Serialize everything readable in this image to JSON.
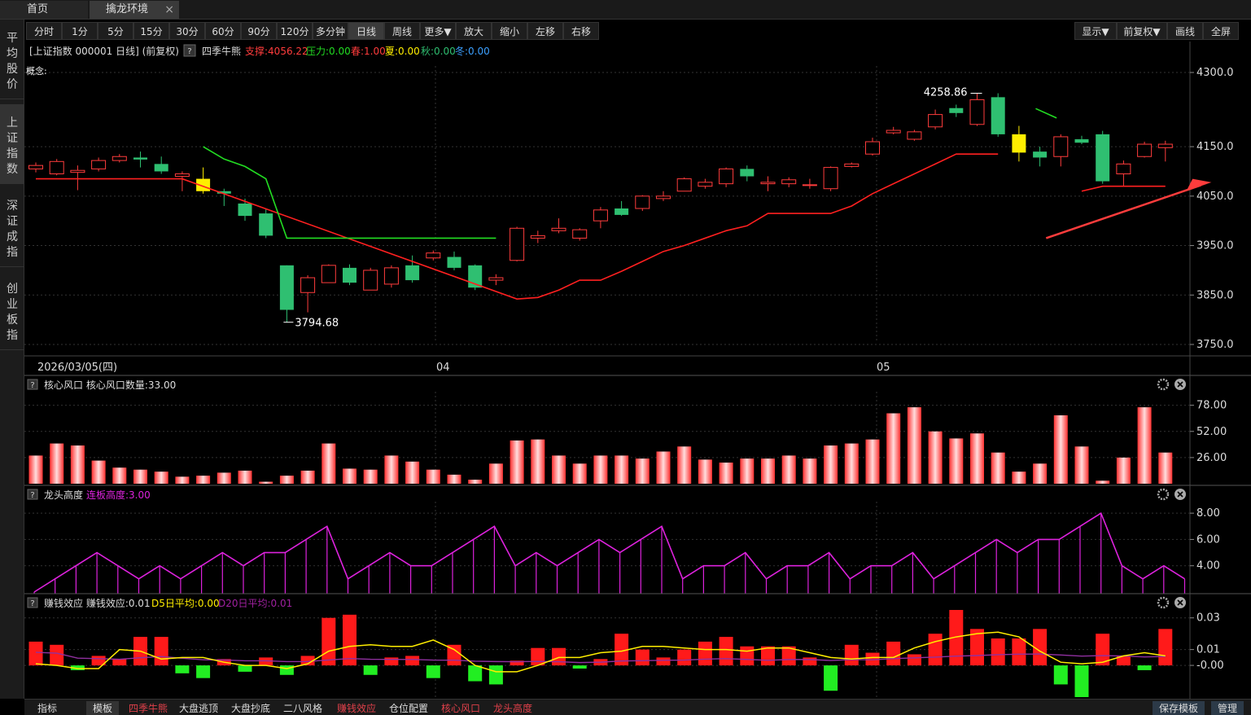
{
  "window_tabs": {
    "home": "首页",
    "env": "擒龙环境",
    "close": "×"
  },
  "left_nav": [
    "平均股价",
    "上证指数",
    "深证成指",
    "创业板指"
  ],
  "toolbar": {
    "periods": [
      "分时",
      "1分",
      "5分",
      "15分",
      "30分",
      "60分",
      "90分",
      "120分",
      "多分钟",
      "日线",
      "周线",
      "更多▼",
      "放大",
      "缩小",
      "左移",
      "右移"
    ],
    "active": "日线",
    "right": [
      "显示▼",
      "前复权▼",
      "画线",
      "全屏"
    ]
  },
  "main_chart": {
    "info_prefix": "[上证指数 000001 日线]  (前复权)",
    "help": "?",
    "indicator_name": "四季牛熊",
    "support": "支撑:4056.22",
    "pressure": "压力:0.00",
    "spring": "春:1.00",
    "summer": "夏:0.00",
    "autumn": "秋:0.00",
    "winter": "冬:0.00",
    "concept": "概念:",
    "date_label": "2026/03/05(四)",
    "month_labels": [
      "04",
      "05"
    ],
    "high_label": "4258.86",
    "low_label": "3794.68",
    "y_ticks": [
      "4300.0",
      "4150.0",
      "4050.0",
      "3950.0",
      "3850.0",
      "3750.0"
    ]
  },
  "panel1": {
    "help": "?",
    "title": "核心风口 核心风口数量:33.00",
    "y_ticks": [
      "78.00",
      "52.00",
      "26.00"
    ]
  },
  "panel2": {
    "help": "?",
    "title": "龙头高度",
    "value": "连板高度:3.00",
    "y_ticks": [
      "8.00",
      "6.00",
      "4.00"
    ]
  },
  "panel3": {
    "help": "?",
    "title": "赚钱效应 赚钱效应:0.01",
    "d5": "D5日平均:0.00",
    "d20": "D20日平均:0.01",
    "y_ticks": [
      "0.03",
      "0.01",
      "-0.00"
    ]
  },
  "bottom": {
    "left": [
      "指标",
      "模板",
      "四季牛熊",
      "大盘逃顶",
      "大盘抄底",
      "二八风格",
      "赚钱效应",
      "仓位配置",
      "核心风口",
      "龙头高度"
    ],
    "right": [
      "保存模板",
      "管理"
    ]
  },
  "colors": {
    "up": "#ff3c3c",
    "down": "#2fbf71",
    "support_line": "#ff2020",
    "pressure_line": "#22dd22",
    "magenta": "#dd22dd",
    "yellow": "#ffee00"
  },
  "chart_data": [
    {
      "type": "candlestick",
      "title": "上证指数 000001 日线",
      "ylim": [
        3750,
        4300
      ],
      "candles": [
        {
          "o": 4105,
          "c": 4112,
          "h": 4118,
          "l": 4098
        },
        {
          "o": 4095,
          "c": 4120,
          "h": 4125,
          "l": 4092
        },
        {
          "o": 4098,
          "c": 4102,
          "h": 4112,
          "l": 4062
        },
        {
          "o": 4105,
          "c": 4122,
          "h": 4128,
          "l": 4100
        },
        {
          "o": 4122,
          "c": 4130,
          "h": 4135,
          "l": 4118
        },
        {
          "o": 4128,
          "c": 4124,
          "h": 4140,
          "l": 4108
        },
        {
          "o": 4115,
          "c": 4100,
          "h": 4130,
          "l": 4095
        },
        {
          "o": 4090,
          "c": 4095,
          "h": 4100,
          "l": 4060
        },
        {
          "o": 4085,
          "c": 4060,
          "h": 4108,
          "l": 4055
        },
        {
          "o": 4060,
          "c": 4055,
          "h": 4065,
          "l": 4030
        },
        {
          "o": 4035,
          "c": 4010,
          "h": 4045,
          "l": 4000
        },
        {
          "o": 4015,
          "c": 3970,
          "h": 4025,
          "l": 3965
        },
        {
          "o": 3910,
          "c": 3820,
          "h": 3910,
          "l": 3795
        },
        {
          "o": 3855,
          "c": 3885,
          "h": 3890,
          "l": 3815
        },
        {
          "o": 3875,
          "c": 3910,
          "h": 3912,
          "l": 3875
        },
        {
          "o": 3905,
          "c": 3875,
          "h": 3912,
          "l": 3870
        },
        {
          "o": 3860,
          "c": 3900,
          "h": 3905,
          "l": 3860
        },
        {
          "o": 3872,
          "c": 3905,
          "h": 3910,
          "l": 3865
        },
        {
          "o": 3910,
          "c": 3880,
          "h": 3930,
          "l": 3875
        },
        {
          "o": 3925,
          "c": 3935,
          "h": 3940,
          "l": 3920
        },
        {
          "o": 3927,
          "c": 3905,
          "h": 3938,
          "l": 3900
        },
        {
          "o": 3910,
          "c": 3865,
          "h": 3912,
          "l": 3860
        },
        {
          "o": 3880,
          "c": 3885,
          "h": 3892,
          "l": 3870
        },
        {
          "o": 3920,
          "c": 3985,
          "h": 3988,
          "l": 3918
        },
        {
          "o": 3965,
          "c": 3970,
          "h": 3980,
          "l": 3955
        },
        {
          "o": 3980,
          "c": 3985,
          "h": 4005,
          "l": 3975
        },
        {
          "o": 3965,
          "c": 3982,
          "h": 3985,
          "l": 3960
        },
        {
          "o": 4000,
          "c": 4022,
          "h": 4028,
          "l": 3985
        },
        {
          "o": 4025,
          "c": 4012,
          "h": 4040,
          "l": 4010
        },
        {
          "o": 4025,
          "c": 4050,
          "h": 4052,
          "l": 4020
        },
        {
          "o": 4045,
          "c": 4050,
          "h": 4060,
          "l": 4040
        },
        {
          "o": 4060,
          "c": 4085,
          "h": 4088,
          "l": 4060
        },
        {
          "o": 4070,
          "c": 4078,
          "h": 4085,
          "l": 4065
        },
        {
          "o": 4075,
          "c": 4105,
          "h": 4108,
          "l": 4068
        },
        {
          "o": 4105,
          "c": 4090,
          "h": 4112,
          "l": 4080
        },
        {
          "o": 4075,
          "c": 4078,
          "h": 4090,
          "l": 4060
        },
        {
          "o": 4075,
          "c": 4083,
          "h": 4088,
          "l": 4068
        },
        {
          "o": 4072,
          "c": 4073,
          "h": 4085,
          "l": 4065
        },
        {
          "o": 4065,
          "c": 4108,
          "h": 4110,
          "l": 4060
        },
        {
          "o": 4110,
          "c": 4115,
          "h": 4118,
          "l": 4108
        },
        {
          "o": 4135,
          "c": 4160,
          "h": 4168,
          "l": 4132
        },
        {
          "o": 4178,
          "c": 4183,
          "h": 4190,
          "l": 4175
        },
        {
          "o": 4165,
          "c": 4180,
          "h": 4184,
          "l": 4162
        },
        {
          "o": 4190,
          "c": 4215,
          "h": 4225,
          "l": 4185
        },
        {
          "o": 4228,
          "c": 4218,
          "h": 4235,
          "l": 4210
        },
        {
          "o": 4195,
          "c": 4245,
          "h": 4258,
          "l": 4192
        },
        {
          "o": 4250,
          "c": 4175,
          "h": 4258,
          "l": 4170
        },
        {
          "o": 4175,
          "c": 4138,
          "h": 4192,
          "l": 4120
        },
        {
          "o": 4140,
          "c": 4128,
          "h": 4150,
          "l": 4110
        },
        {
          "o": 4130,
          "c": 4170,
          "h": 4175,
          "l": 4110
        },
        {
          "o": 4165,
          "c": 4158,
          "h": 4172,
          "l": 4155
        },
        {
          "o": 4175,
          "c": 4080,
          "h": 4182,
          "l": 4075
        },
        {
          "o": 4095,
          "c": 4115,
          "h": 4122,
          "l": 4070
        },
        {
          "o": 4130,
          "c": 4155,
          "h": 4160,
          "l": 4128
        },
        {
          "o": 4148,
          "c": 4155,
          "h": 4162,
          "l": 4120
        }
      ],
      "support_line": [
        [
          0,
          4085
        ],
        [
          7,
          4085
        ],
        [
          23,
          3842
        ],
        [
          24,
          3845
        ],
        [
          25,
          3860
        ],
        [
          26,
          3880
        ],
        [
          27,
          3880
        ],
        [
          28,
          3898
        ],
        [
          29,
          3918
        ],
        [
          30,
          3938
        ],
        [
          31,
          3950
        ],
        [
          32,
          3965
        ],
        [
          33,
          3980
        ],
        [
          34,
          3990
        ],
        [
          35,
          4015
        ],
        [
          36,
          4015
        ],
        [
          37,
          4015
        ],
        [
          38,
          4015
        ],
        [
          39,
          4030
        ],
        [
          40,
          4055
        ],
        [
          41,
          4075
        ],
        [
          42,
          4095
        ],
        [
          43,
          4115
        ],
        [
          44,
          4135
        ],
        [
          45,
          4135
        ],
        [
          46,
          4135
        ],
        [
          49,
          null
        ],
        [
          50,
          4060
        ],
        [
          51,
          4070
        ],
        [
          54,
          4070
        ]
      ],
      "pressure_line": [
        [
          8,
          4150
        ],
        [
          9,
          4125
        ],
        [
          10,
          4110
        ],
        [
          11,
          4085
        ],
        [
          12,
          3965
        ],
        [
          22,
          3965
        ]
      ]
    },
    {
      "type": "bar",
      "title": "核心风口",
      "ylim": [
        0,
        85
      ],
      "values": [
        28,
        40,
        38,
        23,
        16,
        14,
        12,
        7,
        8,
        11,
        13,
        2,
        8,
        13,
        40,
        15,
        14,
        28,
        22,
        14,
        9,
        4,
        20,
        43,
        44,
        28,
        20,
        28,
        28,
        25,
        32,
        37,
        24,
        21,
        25,
        25,
        28,
        25,
        38,
        40,
        44,
        70,
        76,
        52,
        45,
        50,
        31,
        12,
        20,
        68,
        37,
        3,
        26,
        76,
        31
      ]
    },
    {
      "type": "line",
      "title": "龙头高度",
      "ylim": [
        2,
        9
      ],
      "values": [
        2,
        3,
        4,
        5,
        4,
        3,
        4,
        3,
        4,
        5,
        4,
        5,
        5,
        6,
        7,
        3,
        4,
        5,
        4,
        4,
        5,
        6,
        7,
        4,
        5,
        4,
        5,
        6,
        5,
        6,
        7,
        3,
        4,
        4,
        5,
        3,
        4,
        4,
        5,
        3,
        4,
        4,
        5,
        3,
        4,
        5,
        6,
        5,
        6,
        6,
        7,
        8,
        4,
        3,
        4,
        3
      ]
    },
    {
      "type": "bar",
      "title": "赚钱效应",
      "ylim": [
        -0.02,
        0.035
      ],
      "values": [
        0.015,
        0.013,
        -0.003,
        0.006,
        0.004,
        0.018,
        0.018,
        -0.005,
        -0.008,
        0.004,
        -0.004,
        0.005,
        -0.006,
        0.006,
        0.03,
        0.032,
        -0.006,
        0.005,
        0.006,
        -0.008,
        0.013,
        -0.01,
        -0.012,
        0.003,
        0.011,
        0.011,
        -0.002,
        0.004,
        0.02,
        0.01,
        0.005,
        0.01,
        0.015,
        0.018,
        0.012,
        0.012,
        0.012,
        0.005,
        -0.016,
        0.013,
        0.008,
        0.015,
        0.007,
        0.02,
        0.035,
        0.023,
        0.017,
        0.017,
        0.023,
        -0.012,
        -0.02,
        0.02,
        0.006,
        -0.003,
        0.023,
        0.007
      ],
      "d5": [
        0.001,
        0.0,
        -0.002,
        -0.002,
        0.01,
        0.009,
        0.004,
        0.005,
        0.005,
        0.002,
        0.0,
        0.0,
        -0.002,
        0.001,
        0.009,
        0.012,
        0.013,
        0.012,
        0.012,
        0.016,
        0.01,
        0.0,
        -0.004,
        -0.004,
        0.0,
        0.005,
        0.005,
        0.008,
        0.009,
        0.012,
        0.012,
        0.011,
        0.01,
        0.01,
        0.009,
        0.011,
        0.011,
        0.008,
        0.005,
        0.004,
        0.005,
        0.005,
        0.011,
        0.015,
        0.018,
        0.02,
        0.021,
        0.018,
        0.009,
        0.002,
        0.001,
        0.002,
        0.006,
        0.008,
        0.006
      ]
    }
  ]
}
